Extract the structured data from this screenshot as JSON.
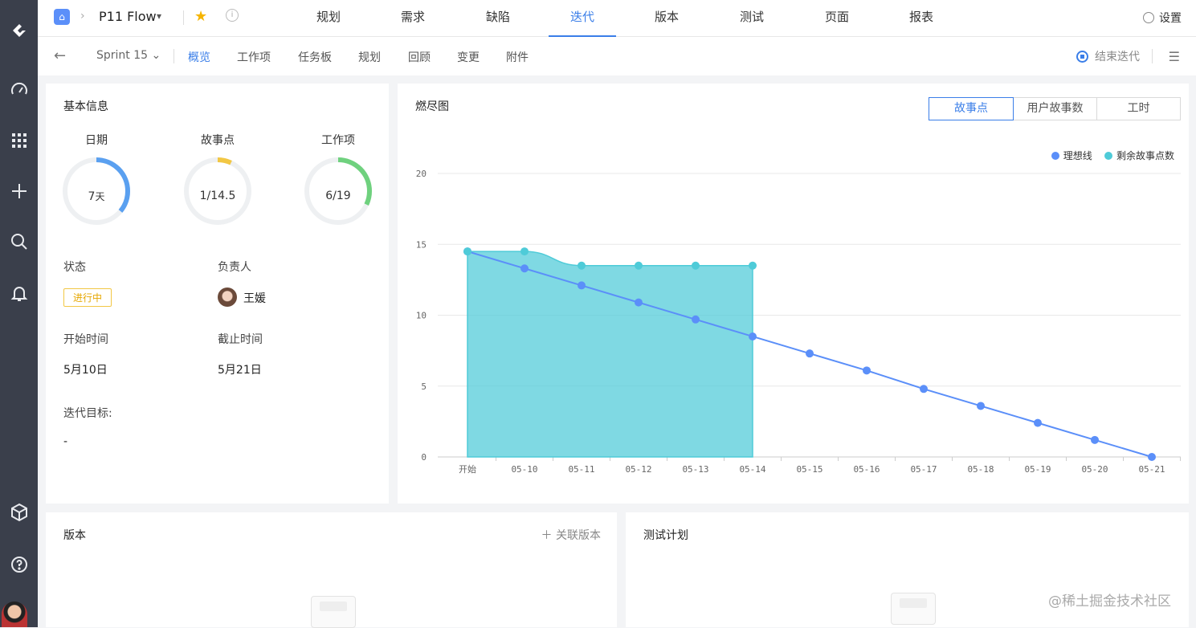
{
  "topbar": {
    "project_name": "P11 Flow",
    "tabs": [
      "规划",
      "需求",
      "缺陷",
      "迭代",
      "版本",
      "测试",
      "页面",
      "报表"
    ],
    "active_tab": "迭代",
    "settings_label": "设置"
  },
  "subbar": {
    "sprint": "Sprint 15",
    "tabs": [
      "概览",
      "工作项",
      "任务板",
      "规划",
      "回顾",
      "变更",
      "附件"
    ],
    "active_tab": "概览",
    "end_sprint_label": "结束迭代"
  },
  "info": {
    "title": "基本信息",
    "gauges": [
      {
        "label": "日期",
        "value_num": "7",
        "value_unit": "天",
        "fraction": 0.36,
        "color": "#5aa0f0"
      },
      {
        "label": "故事点",
        "value": "1/14.5",
        "fraction": 0.07,
        "color": "#f2c744"
      },
      {
        "label": "工作项",
        "value": "6/19",
        "fraction": 0.32,
        "color": "#6fd17e"
      }
    ],
    "status_label": "状态",
    "status_value": "进行中",
    "owner_label": "负责人",
    "owner_value": "王媛",
    "start_label": "开始时间",
    "start_value": "5月10日",
    "end_label": "截止时间",
    "end_value": "5月21日",
    "goal_label": "迭代目标:",
    "goal_value": "-"
  },
  "burndown": {
    "title": "燃尽图",
    "segments": [
      "故事点",
      "用户故事数",
      "工时"
    ],
    "active_segment": "故事点",
    "legend": [
      {
        "name": "理想线",
        "color": "#5b8ff9"
      },
      {
        "name": "剩余故事点数",
        "color": "#4ecbd8"
      }
    ]
  },
  "chart_data": {
    "type": "area",
    "categories": [
      "开始",
      "05-10",
      "05-11",
      "05-12",
      "05-13",
      "05-14",
      "05-15",
      "05-16",
      "05-17",
      "05-18",
      "05-19",
      "05-20",
      "05-21"
    ],
    "ylim": [
      0,
      20
    ],
    "yticks": [
      0,
      5,
      10,
      15,
      20
    ],
    "series": [
      {
        "name": "理想线",
        "type": "line",
        "values": [
          14.5,
          13.3,
          12.1,
          10.9,
          9.7,
          8.5,
          7.3,
          6.1,
          4.8,
          3.6,
          2.4,
          1.2,
          0
        ]
      },
      {
        "name": "剩余故事点数",
        "type": "area",
        "values": [
          14.5,
          14.5,
          13.5,
          13.5,
          13.5,
          13.5
        ]
      }
    ]
  },
  "version": {
    "title": "版本",
    "link_label": "关联版本"
  },
  "test_plan": {
    "title": "测试计划"
  },
  "watermark": "@稀土掘金技术社区"
}
